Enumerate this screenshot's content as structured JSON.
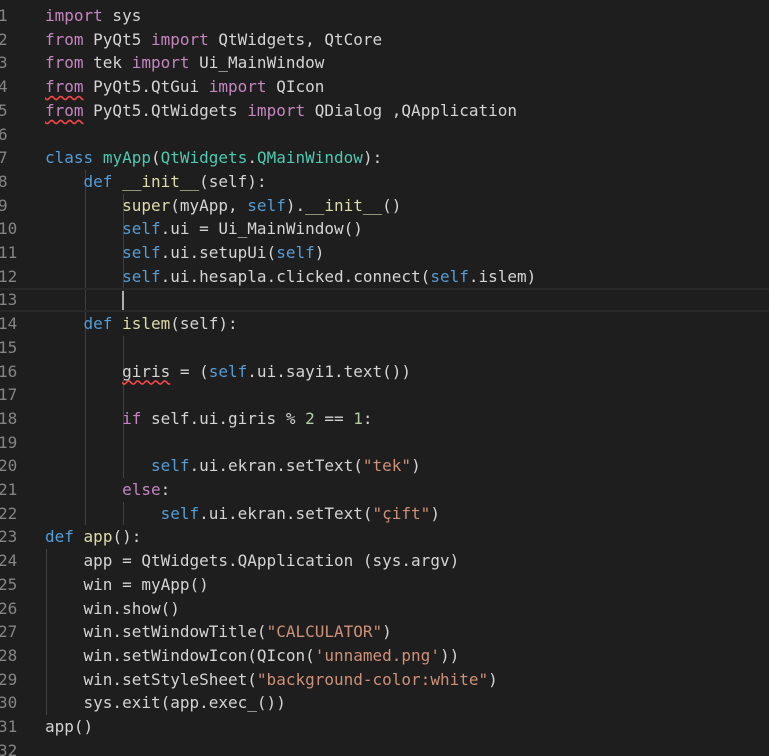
{
  "editor": {
    "line_numbers": [
      "1",
      "2",
      "3",
      "4",
      "5",
      "6",
      "7",
      "8",
      "9",
      "10",
      "11",
      "12",
      "13",
      "14",
      "15",
      "16",
      "17",
      "18",
      "19",
      "20",
      "21",
      "22",
      "23",
      "24",
      "25",
      "26",
      "27",
      "28",
      "29",
      "30",
      "31",
      "32"
    ],
    "lines": [
      [
        {
          "t": "import",
          "c": "kw"
        },
        {
          "t": " sys"
        }
      ],
      [
        {
          "t": "from",
          "c": "kw"
        },
        {
          "t": " PyQt5 "
        },
        {
          "t": "import",
          "c": "kw"
        },
        {
          "t": " QtWidgets, QtCore"
        }
      ],
      [
        {
          "t": "from",
          "c": "kw"
        },
        {
          "t": " tek "
        },
        {
          "t": "import",
          "c": "kw"
        },
        {
          "t": " Ui_MainWindow"
        }
      ],
      [
        {
          "t": "from",
          "c": "kw sq"
        },
        {
          "t": " PyQt5.QtGui "
        },
        {
          "t": "import",
          "c": "kw"
        },
        {
          "t": " QIcon"
        }
      ],
      [
        {
          "t": "from",
          "c": "kw sq"
        },
        {
          "t": " PyQt5.QtWidgets "
        },
        {
          "t": "import",
          "c": "kw"
        },
        {
          "t": " QDialog ,QApplication"
        }
      ],
      [],
      [
        {
          "t": "class",
          "c": "kb"
        },
        {
          "t": " "
        },
        {
          "t": "myApp",
          "c": "cls"
        },
        {
          "t": "("
        },
        {
          "t": "QtWidgets",
          "c": "cls"
        },
        {
          "t": "."
        },
        {
          "t": "QMainWindow",
          "c": "cls"
        },
        {
          "t": "):"
        }
      ],
      [
        {
          "t": "    "
        },
        {
          "t": "def",
          "c": "kb"
        },
        {
          "t": " "
        },
        {
          "t": "__init__",
          "c": "fn"
        },
        {
          "t": "(self):"
        }
      ],
      [
        {
          "t": "        "
        },
        {
          "t": "super",
          "c": "fn"
        },
        {
          "t": "(myApp, "
        },
        {
          "t": "self",
          "c": "kb"
        },
        {
          "t": ")."
        },
        {
          "t": "__init__",
          "c": "fn"
        },
        {
          "t": "()"
        }
      ],
      [
        {
          "t": "        "
        },
        {
          "t": "self",
          "c": "kb"
        },
        {
          "t": ".ui = Ui_MainWindow()"
        }
      ],
      [
        {
          "t": "        "
        },
        {
          "t": "self",
          "c": "kb"
        },
        {
          "t": ".ui.setupUi("
        },
        {
          "t": "self",
          "c": "kb"
        },
        {
          "t": ")"
        }
      ],
      [
        {
          "t": "        "
        },
        {
          "t": "self",
          "c": "kb"
        },
        {
          "t": ".ui.hesapla.clicked.connect("
        },
        {
          "t": "self",
          "c": "kb"
        },
        {
          "t": ".islem)"
        }
      ],
      [],
      [
        {
          "t": "    "
        },
        {
          "t": "def",
          "c": "kb"
        },
        {
          "t": " "
        },
        {
          "t": "islem",
          "c": "fn"
        },
        {
          "t": "(self):"
        }
      ],
      [],
      [
        {
          "t": "        "
        },
        {
          "t": "giris",
          "c": "sq"
        },
        {
          "t": " = ("
        },
        {
          "t": "self",
          "c": "kb"
        },
        {
          "t": ".ui.sayi1.text())"
        }
      ],
      [],
      [
        {
          "t": "        "
        },
        {
          "t": "if",
          "c": "kw"
        },
        {
          "t": " self.ui.giris % "
        },
        {
          "t": "2",
          "c": "num"
        },
        {
          "t": " == "
        },
        {
          "t": "1",
          "c": "num"
        },
        {
          "t": ":"
        }
      ],
      [],
      [
        {
          "t": "           "
        },
        {
          "t": "self",
          "c": "kb"
        },
        {
          "t": ".ui.ekran.setText("
        },
        {
          "t": "\"tek\"",
          "c": "str"
        },
        {
          "t": ")"
        }
      ],
      [
        {
          "t": "        "
        },
        {
          "t": "else",
          "c": "kw"
        },
        {
          "t": ":"
        }
      ],
      [
        {
          "t": "            "
        },
        {
          "t": "self",
          "c": "kb"
        },
        {
          "t": ".ui.ekran.setText("
        },
        {
          "t": "\"çift\"",
          "c": "str"
        },
        {
          "t": ")"
        }
      ],
      [
        {
          "t": "def",
          "c": "kb"
        },
        {
          "t": " "
        },
        {
          "t": "app",
          "c": "fn"
        },
        {
          "t": "():"
        }
      ],
      [
        {
          "t": "    app = QtWidgets.QApplication (sys.argv)"
        }
      ],
      [
        {
          "t": "    win = myApp()"
        }
      ],
      [
        {
          "t": "    win.show()"
        }
      ],
      [
        {
          "t": "    win.setWindowTitle("
        },
        {
          "t": "\"CALCULATOR\"",
          "c": "str"
        },
        {
          "t": ")"
        }
      ],
      [
        {
          "t": "    win.setWindowIcon(QIcon("
        },
        {
          "t": "'unnamed.png'",
          "c": "str"
        },
        {
          "t": "))"
        }
      ],
      [
        {
          "t": "    win.setStyleSheet("
        },
        {
          "t": "\"background-color:white\"",
          "c": "str"
        },
        {
          "t": ")"
        }
      ],
      [
        {
          "t": "    sys.exit(app.exec_())"
        }
      ],
      [
        {
          "t": "app()"
        }
      ],
      []
    ],
    "current_line": 13
  }
}
